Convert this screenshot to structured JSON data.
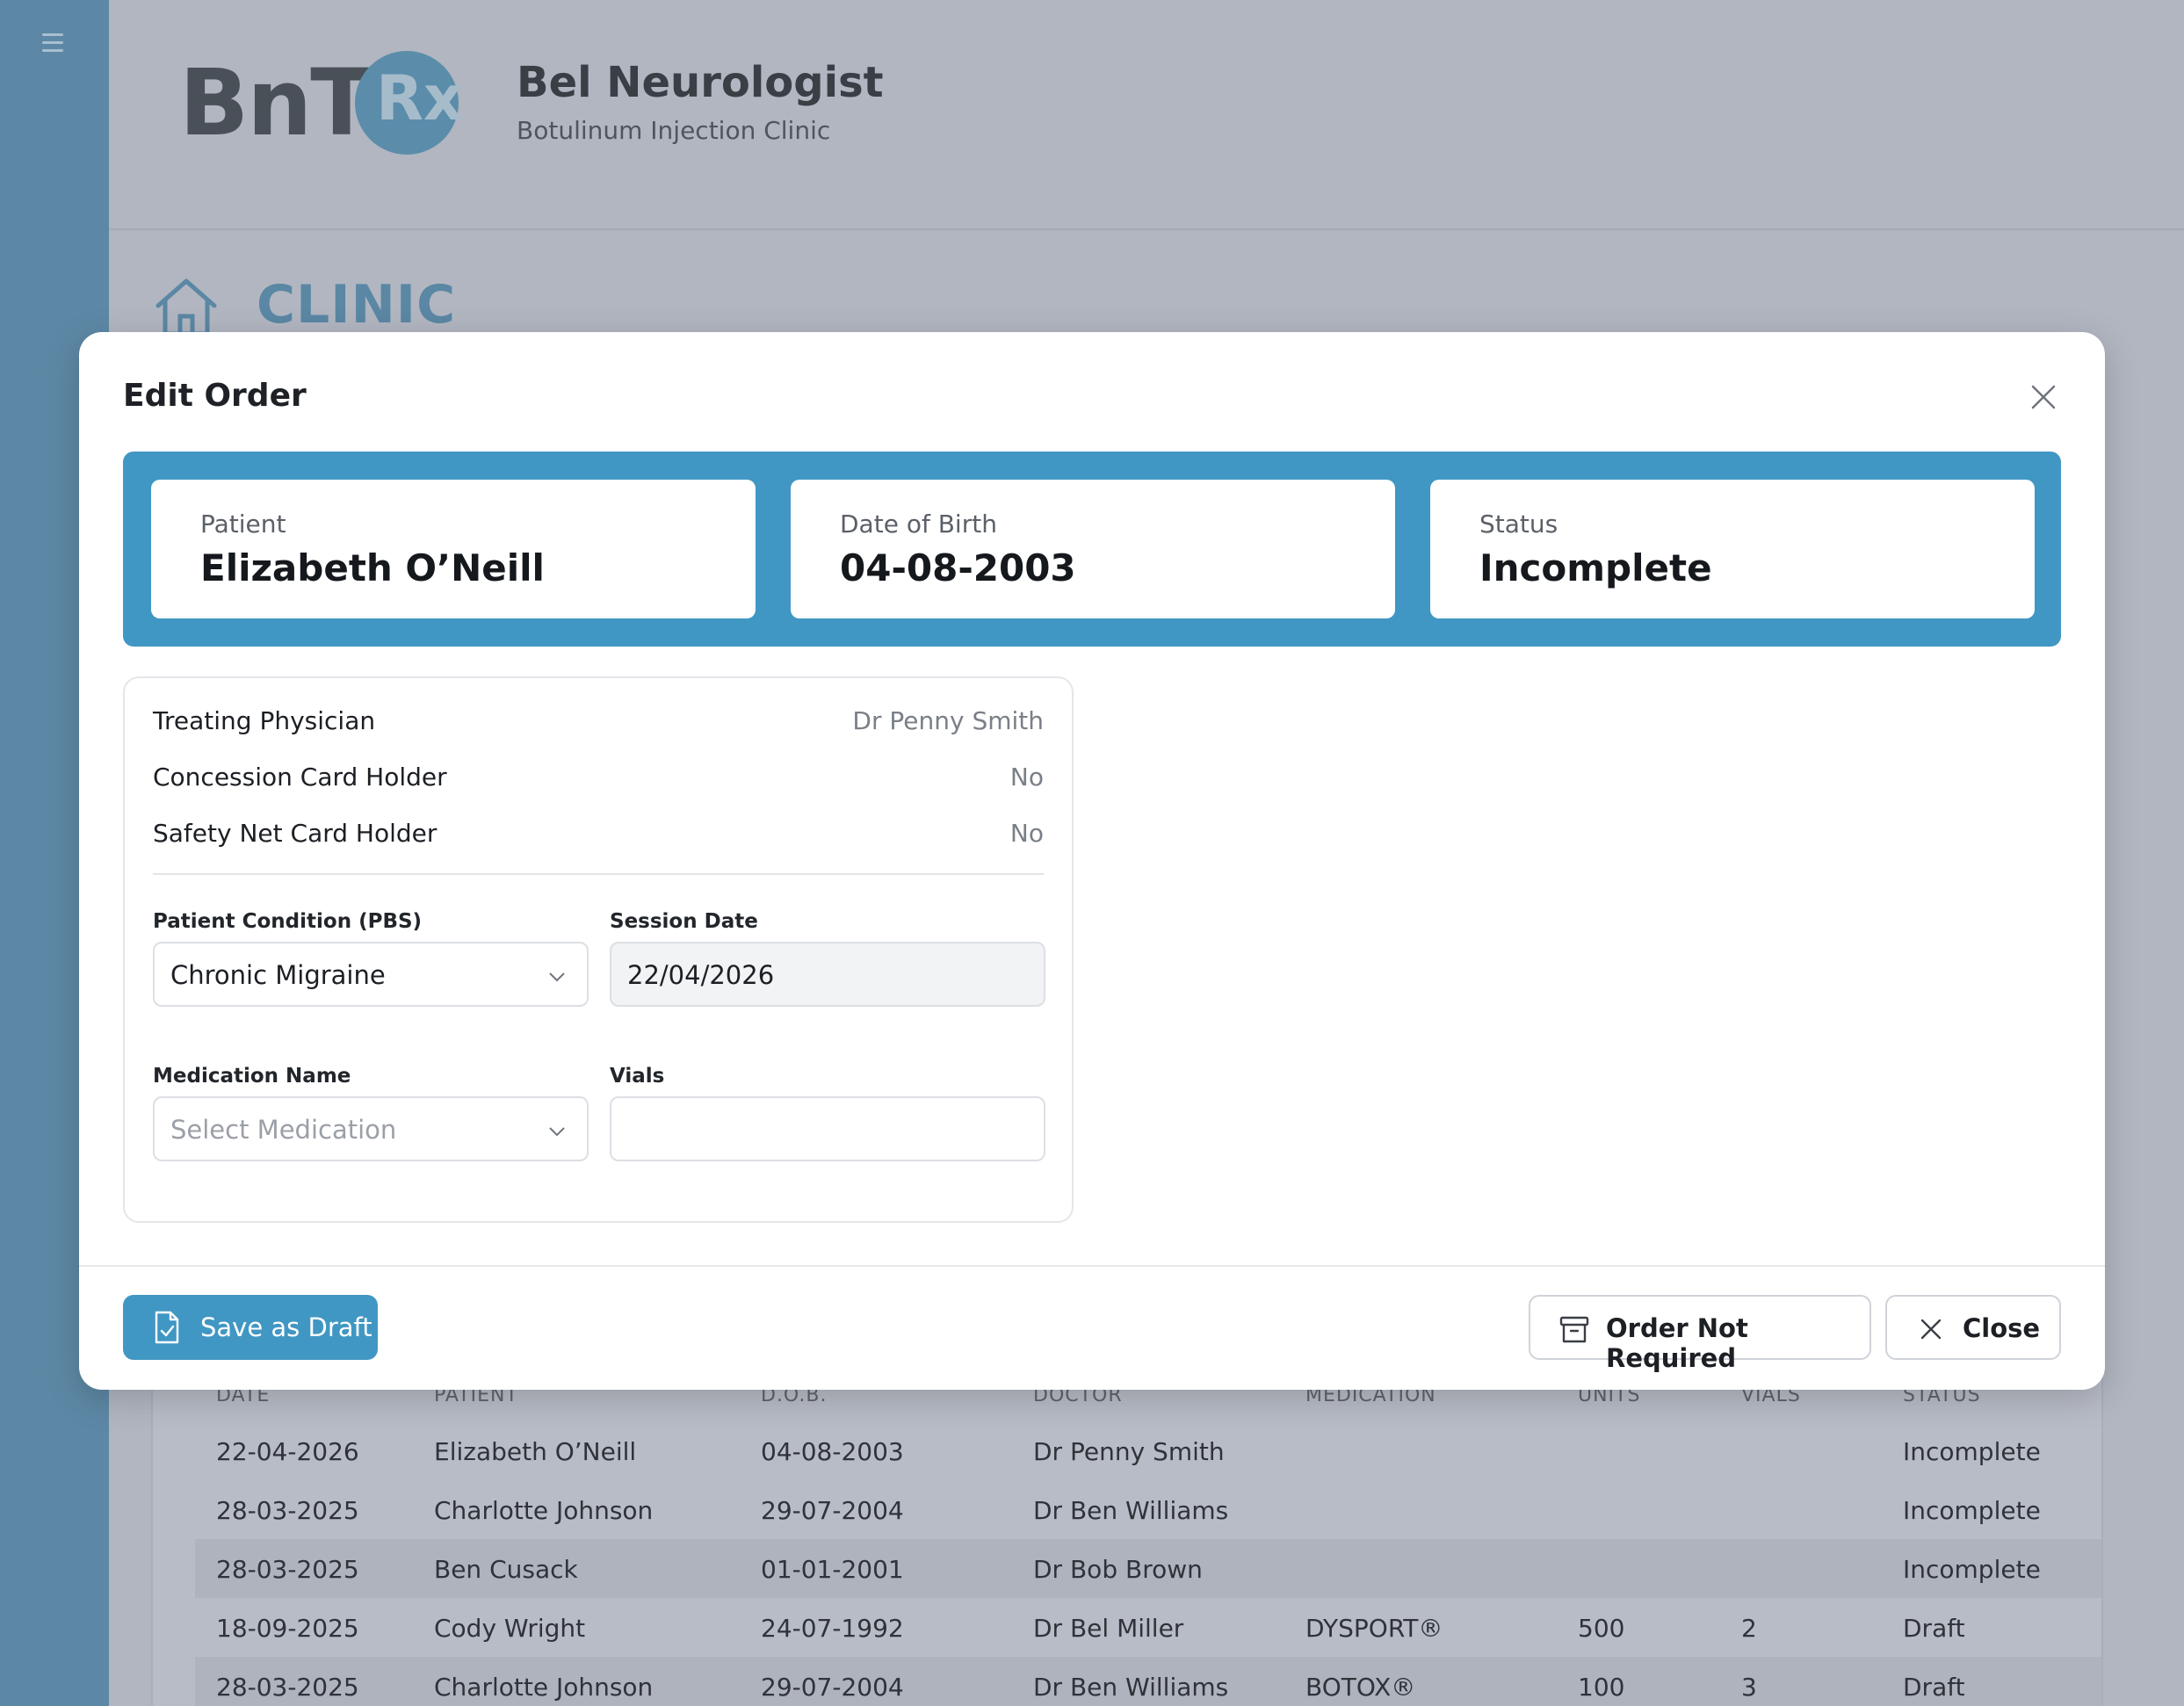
{
  "app": {
    "logo_text": "BnT",
    "logo_rx": "Rx",
    "brand_title": "Bel Neurologist",
    "brand_subtitle": "Botulinum Injection Clinic",
    "page_title": "CLINIC"
  },
  "colors": {
    "accent": "#4197c3",
    "sidebar": "#5d88a5",
    "overlay_background": "#b1b6c1"
  },
  "modal": {
    "title": "Edit Order",
    "summary": [
      {
        "label": "Patient",
        "value": "Elizabeth O’Neill"
      },
      {
        "label": "Date of Birth",
        "value": "04-08-2003"
      },
      {
        "label": "Status",
        "value": "Incomplete"
      }
    ],
    "info": [
      {
        "label": "Treating Physician",
        "value": "Dr Penny Smith"
      },
      {
        "label": "Concession Card Holder",
        "value": "No"
      },
      {
        "label": "Safety Net Card Holder",
        "value": "No"
      }
    ],
    "condition": {
      "label": "Patient Condition (PBS)",
      "value": "Chronic Migraine"
    },
    "session_date": {
      "label": "Session Date",
      "value": "22/04/2026"
    },
    "medication": {
      "label": "Medication Name",
      "placeholder": "Select Medication"
    },
    "vials": {
      "label": "Vials",
      "value": ""
    },
    "buttons": {
      "save_draft": "Save as Draft",
      "order_not_required": "Order Not Required",
      "close": "Close"
    }
  },
  "table": {
    "headers": [
      "DATE",
      "PATIENT",
      "D.O.B.",
      "DOCTOR",
      "MEDICATION",
      "UNITS",
      "VIALS",
      "STATUS"
    ],
    "rows": [
      [
        "22-04-2026",
        "Elizabeth O’Neill",
        "04-08-2003",
        "Dr Penny Smith",
        "",
        "",
        "",
        "Incomplete"
      ],
      [
        "28-03-2025",
        "Charlotte Johnson",
        "29-07-2004",
        "Dr Ben Williams",
        "",
        "",
        "",
        "Incomplete"
      ],
      [
        "28-03-2025",
        "Ben Cusack",
        "01-01-2001",
        "Dr Bob Brown",
        "",
        "",
        "",
        "Incomplete"
      ],
      [
        "18-09-2025",
        "Cody Wright",
        "24-07-1992",
        "Dr Bel Miller",
        "DYSPORT®",
        "500",
        "2",
        "Draft"
      ],
      [
        "28-03-2025",
        "Charlotte Johnson",
        "29-07-2004",
        "Dr Ben Williams",
        "BOTOX®",
        "100",
        "3",
        "Draft"
      ]
    ]
  }
}
